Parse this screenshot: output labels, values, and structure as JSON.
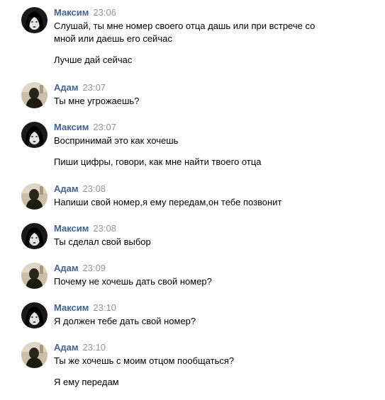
{
  "messages": [
    {
      "author": "Максим",
      "avatar": "maxim-avatar",
      "time": "23:06",
      "lines": [
        "Слушай, ты мне номер своего отца дашь или при встрече со",
        "мной или даешь его сейчас"
      ],
      "extra": "Лучше дай сейчас"
    },
    {
      "author": "Адам",
      "avatar": "adam-avatar",
      "time": "23:07",
      "lines": [
        "Ты мне угрожаешь?"
      ]
    },
    {
      "author": "Максим",
      "avatar": "maxim-avatar",
      "time": "23:07",
      "lines": [
        "Воспринимай это как хочешь"
      ],
      "extra": "Пиши цифры, говори, как мне найти твоего отца"
    },
    {
      "author": "Адам",
      "avatar": "adam-avatar",
      "time": "23:08",
      "lines": [
        "Напиши свой номер,я ему передам,он тебе позвонит"
      ]
    },
    {
      "author": "Максим",
      "avatar": "maxim-avatar",
      "time": "23:08",
      "lines": [
        "Ты сделал свой выбор"
      ]
    },
    {
      "author": "Адам",
      "avatar": "adam-avatar",
      "time": "23:09",
      "lines": [
        "Почему не хочешь дать свой номер?"
      ]
    },
    {
      "author": "Максим",
      "avatar": "maxim-avatar",
      "time": "23:10",
      "lines": [
        "Я должен тебе дать свой номер?"
      ]
    },
    {
      "author": "Адам",
      "avatar": "adam-avatar",
      "time": "23:10",
      "lines": [
        "Ты же хочешь с моим отцом пообщаться?"
      ],
      "extra": "Я ему передам"
    }
  ],
  "colors": {
    "author": "#42648b",
    "time": "#939393",
    "text": "#000000",
    "background": "#ffffff"
  }
}
